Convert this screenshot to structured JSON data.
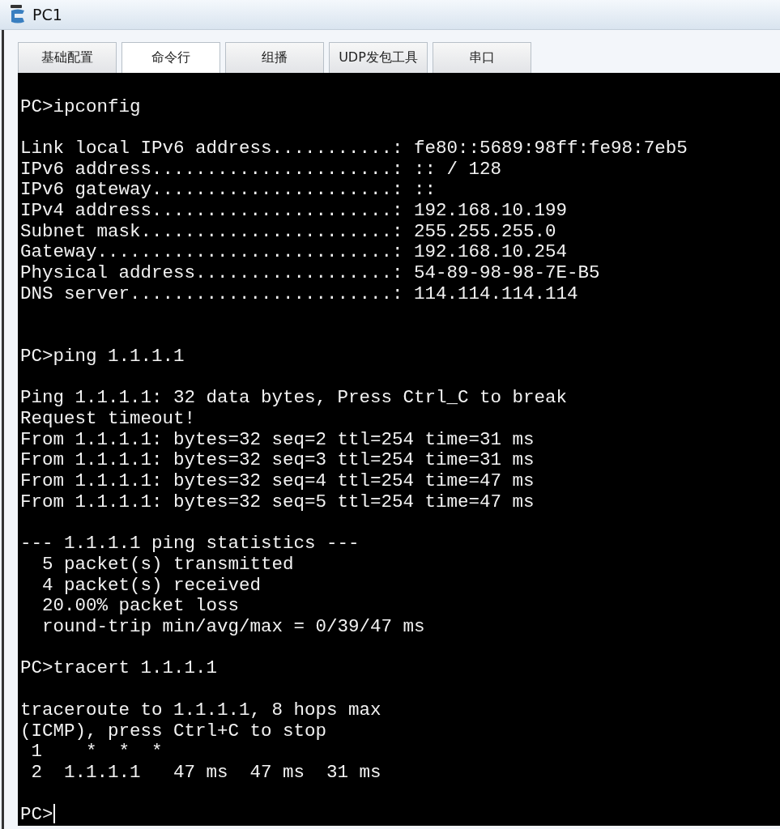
{
  "window": {
    "title": "PC1"
  },
  "tabs": [
    {
      "label": "基础配置",
      "selected": false
    },
    {
      "label": "命令行",
      "selected": true
    },
    {
      "label": "组播",
      "selected": false
    },
    {
      "label": "UDP发包工具",
      "selected": false
    },
    {
      "label": "串口",
      "selected": false
    }
  ],
  "terminal": {
    "groups": [
      {
        "lines": [
          "PC>ipconfig"
        ]
      },
      {
        "lines": [
          "Link local IPv6 address...........: fe80::5689:98ff:fe98:7eb5",
          "IPv6 address......................: :: / 128",
          "IPv6 gateway......................: ::",
          "IPv4 address......................: 192.168.10.199",
          "Subnet mask.......................: 255.255.255.0",
          "Gateway...........................: 192.168.10.254",
          "Physical address..................: 54-89-98-98-7E-B5",
          "DNS server........................: 114.114.114.114"
        ]
      },
      {
        "lines": [
          "PC>ping 1.1.1.1"
        ]
      },
      {
        "lines": [
          "Ping 1.1.1.1: 32 data bytes, Press Ctrl_C to break",
          "Request timeout!",
          "From 1.1.1.1: bytes=32 seq=2 ttl=254 time=31 ms",
          "From 1.1.1.1: bytes=32 seq=3 ttl=254 time=31 ms",
          "From 1.1.1.1: bytes=32 seq=4 ttl=254 time=47 ms",
          "From 1.1.1.1: bytes=32 seq=5 ttl=254 time=47 ms"
        ]
      },
      {
        "lines": [
          "--- 1.1.1.1 ping statistics ---",
          "  5 packet(s) transmitted",
          "  4 packet(s) received",
          "  20.00% packet loss",
          "  round-trip min/avg/max = 0/39/47 ms"
        ]
      },
      {
        "lines": [
          "PC>tracert 1.1.1.1"
        ]
      },
      {
        "lines": [
          "traceroute to 1.1.1.1, 8 hops max",
          "(ICMP), press Ctrl+C to stop",
          " 1    *  *  *",
          " 2  1.1.1.1   47 ms  47 ms  31 ms"
        ]
      },
      {
        "lines": [
          "PC>"
        ]
      }
    ]
  }
}
